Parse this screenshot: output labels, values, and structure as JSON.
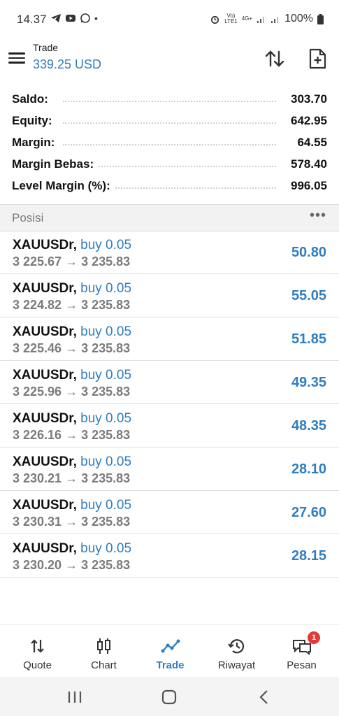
{
  "status_bar": {
    "time": "14.37",
    "battery": "100%",
    "network_top": "Vo)",
    "network_bottom": "LTE1",
    "net_type": "4G+"
  },
  "header": {
    "title": "Trade",
    "balance": "339.25 USD"
  },
  "account": [
    {
      "label": "Saldo:",
      "value": "303.70"
    },
    {
      "label": "Equity:",
      "value": "642.95"
    },
    {
      "label": "Margin:",
      "value": "64.55"
    },
    {
      "label": "Margin Bebas:",
      "value": "578.40"
    },
    {
      "label": "Level Margin (%):",
      "value": "996.05"
    }
  ],
  "positions_header": {
    "label": "Posisi",
    "more": "•••"
  },
  "positions": [
    {
      "symbol": "XAUUSDr,",
      "side": "buy 0.05",
      "prices": "3 225.67 → 3 235.83",
      "profit": "50.80"
    },
    {
      "symbol": "XAUUSDr,",
      "side": "buy 0.05",
      "prices": "3 224.82 → 3 235.83",
      "profit": "55.05"
    },
    {
      "symbol": "XAUUSDr,",
      "side": "buy 0.05",
      "prices": "3 225.46 → 3 235.83",
      "profit": "51.85"
    },
    {
      "symbol": "XAUUSDr,",
      "side": "buy 0.05",
      "prices": "3 225.96 → 3 235.83",
      "profit": "49.35"
    },
    {
      "symbol": "XAUUSDr,",
      "side": "buy 0.05",
      "prices": "3 226.16 → 3 235.83",
      "profit": "48.35"
    },
    {
      "symbol": "XAUUSDr,",
      "side": "buy 0.05",
      "prices": "3 230.21 → 3 235.83",
      "profit": "28.10"
    },
    {
      "symbol": "XAUUSDr,",
      "side": "buy 0.05",
      "prices": "3 230.31 → 3 235.83",
      "profit": "27.60"
    },
    {
      "symbol": "XAUUSDr,",
      "side": "buy 0.05",
      "prices": "3 230.20 → 3 235.83",
      "profit": "28.15"
    }
  ],
  "bottom_nav": [
    {
      "label": "Quote",
      "icon": "quote-arrows-icon"
    },
    {
      "label": "Chart",
      "icon": "candlestick-icon"
    },
    {
      "label": "Trade",
      "icon": "trade-line-icon",
      "active": true
    },
    {
      "label": "Riwayat",
      "icon": "history-icon"
    },
    {
      "label": "Pesan",
      "icon": "chat-icon",
      "badge": "1"
    }
  ],
  "colors": {
    "accent": "#2f7ec1",
    "badge": "#e53935"
  }
}
